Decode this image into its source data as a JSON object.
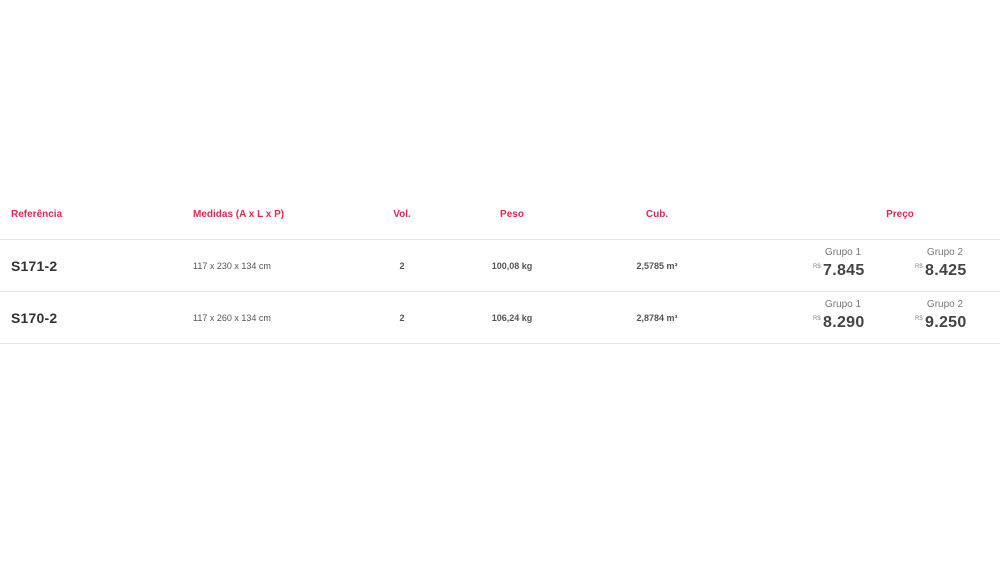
{
  "table": {
    "headers": {
      "referencia": "Referência",
      "medidas": "Medidas (A x L x P)",
      "vol": "Vol.",
      "peso": "Peso",
      "cub": "Cub.",
      "preco": "Preço"
    },
    "rows": [
      {
        "referencia": "S171-2",
        "medidas": "117 x 230 x 134 cm",
        "vol": "2",
        "peso": "100,08 kg",
        "cub": "2,5785 m³",
        "precos": [
          {
            "label": "Grupo 1",
            "currency": "R$",
            "value": "7.845"
          },
          {
            "label": "Grupo 2",
            "currency": "R$",
            "value": "8.425"
          }
        ]
      },
      {
        "referencia": "S170-2",
        "medidas": "117 x 260 x 134 cm",
        "vol": "2",
        "peso": "106,24 kg",
        "cub": "2,8784 m³",
        "precos": [
          {
            "label": "Grupo 1",
            "currency": "R$",
            "value": "8.290"
          },
          {
            "label": "Grupo 2",
            "currency": "R$",
            "value": "9.250"
          }
        ]
      }
    ]
  },
  "colors": {
    "header_text": "#e8264f",
    "row_border": "#e6e6e6",
    "primary_text": "#333333"
  }
}
